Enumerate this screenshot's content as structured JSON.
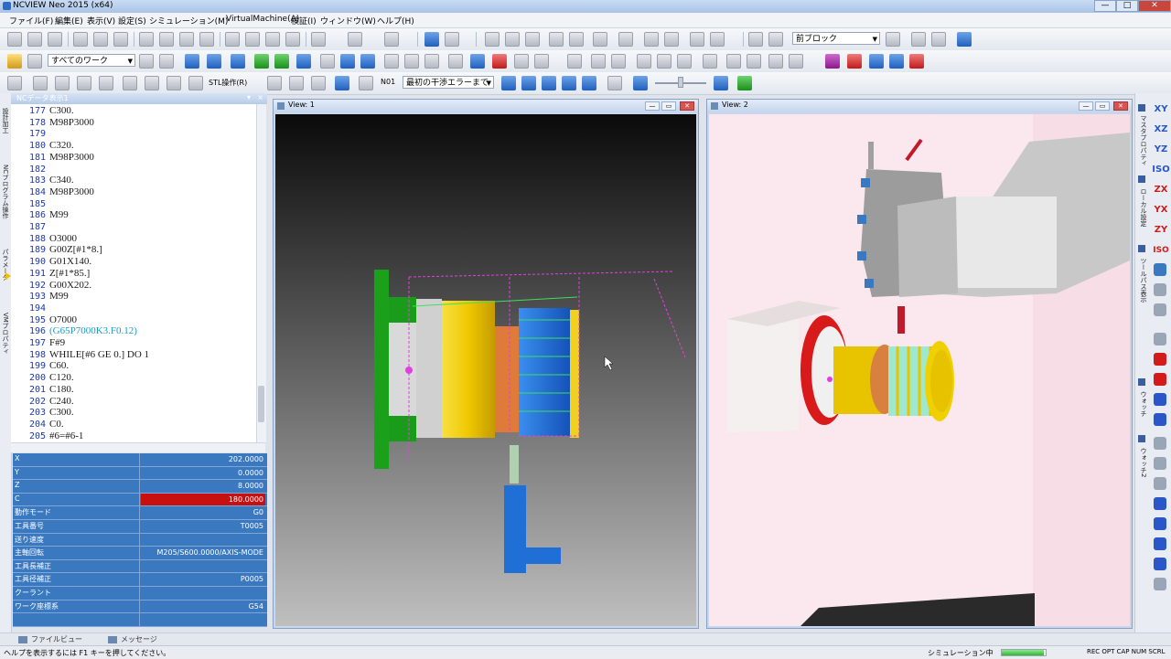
{
  "window": {
    "title": "NCVIEW Neo 2015 (x64)",
    "min": "—",
    "max": "□",
    "close": "✕"
  },
  "menu": [
    "ファイル(F)",
    "編集(E)",
    "表示(V)",
    "設定(S)",
    "シミュレーション(M)",
    "VirtualMachine(A)",
    "検証(I)",
    "ウィンドウ(W)",
    "ヘルプ(H)"
  ],
  "toolbar1": {
    "block_combo": "前ブロック"
  },
  "toolbar2": {
    "work_combo": "すべてのワーク"
  },
  "toolbar3": {
    "stl_label": "STL操作(R)",
    "n01_label": "N01",
    "error_combo": "最初の干渉エラーまで"
  },
  "left_tabs": [
    "設計加工",
    "NCプログラム操作",
    "パラメータ",
    "VMプロパティ"
  ],
  "nc_panel": {
    "title": "NCデータ表示1",
    "lines": [
      {
        "n": "177",
        "t": "C300."
      },
      {
        "n": "178",
        "t": "M98P3000"
      },
      {
        "n": "179",
        "t": ""
      },
      {
        "n": "180",
        "t": "C320."
      },
      {
        "n": "181",
        "t": "M98P3000"
      },
      {
        "n": "182",
        "t": ""
      },
      {
        "n": "183",
        "t": "C340."
      },
      {
        "n": "184",
        "t": "M98P3000"
      },
      {
        "n": "185",
        "t": ""
      },
      {
        "n": "186",
        "t": "M99"
      },
      {
        "n": "187",
        "t": ""
      },
      {
        "n": "188",
        "t": "O3000"
      },
      {
        "n": "189",
        "t": "G00Z[#1*8.]"
      },
      {
        "n": "190",
        "t": "G01X140."
      },
      {
        "n": "191",
        "t": "Z[#1*85.]"
      },
      {
        "n": "192",
        "t": "G00X202."
      },
      {
        "n": "193",
        "t": "M99"
      },
      {
        "n": "194",
        "t": ""
      },
      {
        "n": "195",
        "t": "O7000"
      },
      {
        "n": "196",
        "t": "(G65P7000K3.F0.12)"
      },
      {
        "n": "197",
        "t": "F#9"
      },
      {
        "n": "198",
        "t": "WHILE[#6 GE 0.] DO 1"
      },
      {
        "n": "199",
        "t": "C60."
      },
      {
        "n": "200",
        "t": "C120."
      },
      {
        "n": "201",
        "t": "C180."
      },
      {
        "n": "202",
        "t": "C240."
      },
      {
        "n": "203",
        "t": "C300."
      },
      {
        "n": "204",
        "t": "C0."
      },
      {
        "n": "205",
        "t": "#6=#6-1"
      }
    ]
  },
  "properties": [
    {
      "k": "X",
      "v": "202.0000"
    },
    {
      "k": "Y",
      "v": "0.0000"
    },
    {
      "k": "Z",
      "v": "8.0000"
    },
    {
      "k": "C",
      "v": "180.0000"
    },
    {
      "k": "動作モード",
      "v": "G0"
    },
    {
      "k": "工具番号",
      "v": "T0005"
    },
    {
      "k": "送り速度",
      "v": ""
    },
    {
      "k": "主軸回転",
      "v": "M205/S600.0000/AXIS-MODE"
    },
    {
      "k": "工具長補正",
      "v": ""
    },
    {
      "k": "工具径補正",
      "v": "P0005"
    },
    {
      "k": "クーラント",
      "v": ""
    },
    {
      "k": "ワーク座標系",
      "v": "G54"
    },
    {
      "k": "",
      "v": ""
    }
  ],
  "view1": {
    "title": "View: 1"
  },
  "view2": {
    "title": "View: 2"
  },
  "right_toolbar": {
    "views": [
      "XY",
      "XZ",
      "YZ",
      "ISO",
      "ZX",
      "YX",
      "ZY",
      "ISO"
    ],
    "tabs": [
      "マスタプロパティ",
      "ローカル設定",
      "ツールパス表示",
      "ウォッチ",
      "ウォッチ2"
    ]
  },
  "bottom_tabs": [
    "ファイルビュー",
    "メッセージ"
  ],
  "status": {
    "help": "ヘルプを表示するには F1 キーを押してください。",
    "sim": "シミュレーション中",
    "progress": 0.95,
    "indicators": "REC OPT CAP NUM SCRL"
  },
  "colors": {
    "accent": "#3a78c0",
    "highlight": "#c81010",
    "part_yellow": "#f0c800",
    "chuck_green": "#1a9c1a",
    "tool_blue": "#1f6fd6"
  }
}
